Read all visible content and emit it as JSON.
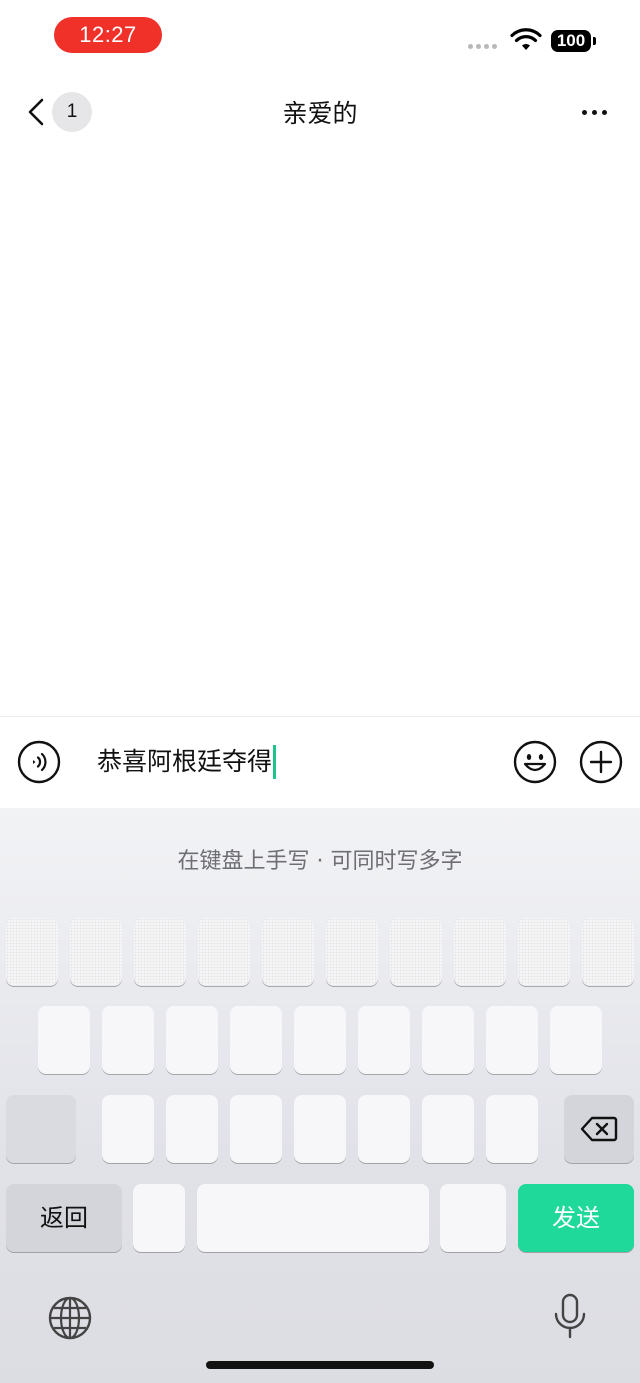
{
  "status_bar": {
    "time": "12:27",
    "battery": "100"
  },
  "nav": {
    "unread_count": "1",
    "title": "亲爱的"
  },
  "input": {
    "text": "恭喜阿根廷夺得"
  },
  "keyboard": {
    "hint": "在键盘上手写 · 可同时写多字",
    "back_label": "返回",
    "send_label": "发送"
  },
  "colors": {
    "time_pill": "#f0312a",
    "send_key": "#1ed99a",
    "caret": "#1ec28b"
  }
}
